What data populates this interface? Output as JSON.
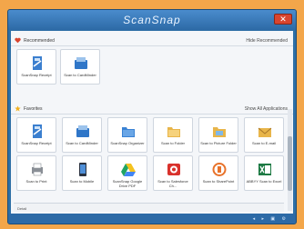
{
  "window": {
    "title": "ScanSnap",
    "close_label": "✕"
  },
  "recommended": {
    "label": "Recommended",
    "link": "Hide Recommended",
    "tiles": [
      {
        "label": "ScanSnap Receipt",
        "icon": "receipt-icon"
      },
      {
        "label": "Scan to CardMinder",
        "icon": "cardminder-icon"
      }
    ]
  },
  "favorites": {
    "label": "Favorites",
    "link": "Show All Applications",
    "tiles": [
      {
        "label": "ScanSnap Receipt",
        "icon": "receipt-icon"
      },
      {
        "label": "Scan to CardMinder",
        "icon": "cardminder-icon"
      },
      {
        "label": "ScanSnap Organizer",
        "icon": "folder-icon"
      },
      {
        "label": "Scan to Folder",
        "icon": "folder-icon"
      },
      {
        "label": "Scan to Picture Folder",
        "icon": "picture-folder-icon"
      },
      {
        "label": "Scan to E-mail",
        "icon": "email-icon"
      },
      {
        "label": "Scan to Print",
        "icon": "printer-icon"
      },
      {
        "label": "Scan to Mobile",
        "icon": "mobile-icon"
      },
      {
        "label": "ScanSnap Google Drive PDF",
        "icon": "google-drive-icon"
      },
      {
        "label": "Scan to Salesforce Ch...",
        "icon": "salesforce-icon"
      },
      {
        "label": "Scan to SharePoint",
        "icon": "sharepoint-icon"
      },
      {
        "label": "ABBYY Scan to Excel",
        "icon": "excel-icon"
      }
    ]
  },
  "footer": {
    "label": "Detail"
  },
  "status": {
    "icons": "◂ ▸ ▣ ⚙"
  },
  "colors": {
    "background": "#f3a64a",
    "window_blue": "#2e6fa6",
    "close_red": "#d9452f"
  }
}
